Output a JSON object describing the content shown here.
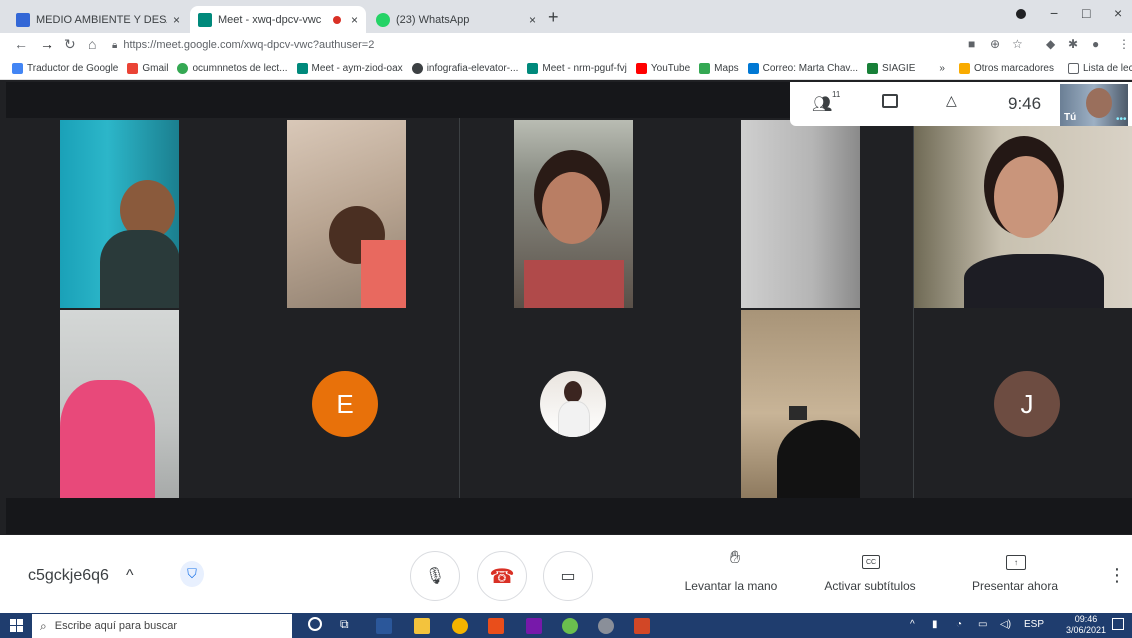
{
  "tabs": [
    {
      "title": "MEDIO AMBIENTE Y DESARROLL",
      "close": "×"
    },
    {
      "title": "Meet - xwq-dpcv-vwc",
      "close": "×"
    },
    {
      "title": "(23) WhatsApp",
      "close": "×"
    }
  ],
  "newtab": "+",
  "window": {
    "minimize": "−",
    "maximize": "□",
    "close": "×"
  },
  "address": {
    "url": "https://meet.google.com/xwq-dpcv-vwc?authuser=2"
  },
  "bookmarks": [
    {
      "label": "Traductor de Google",
      "color": "#4285f4"
    },
    {
      "label": "Gmail",
      "color": "#ea4335"
    },
    {
      "label": "ocumnnetos de lect...",
      "color": "#34a853"
    },
    {
      "label": "Meet - aym-ziod-oax",
      "color": "#00897b"
    },
    {
      "label": "infografia-elevator-...",
      "color": "#3c4043"
    },
    {
      "label": "Meet - nrm-pguf-fvj",
      "color": "#00897b"
    },
    {
      "label": "YouTube",
      "color": "#ff0000"
    },
    {
      "label": "Maps",
      "color": "#34a853"
    },
    {
      "label": "Correo: Marta Chav...",
      "color": "#0078d4"
    },
    {
      "label": "SIAGIE",
      "color": "#188038"
    }
  ],
  "bookmarks_overflow": "»",
  "bookmarks_other": "Otros marcadores",
  "bookmarks_reading": "Lista de lectura",
  "meet": {
    "participants_count": "11",
    "time": "9:46",
    "self_label": "Tú",
    "tiles": [
      {
        "initial": "E",
        "color": "#e8710a"
      },
      {
        "initial": "J",
        "color": "#6d4c41"
      }
    ]
  },
  "controls": {
    "meeting_code": "c5gckje6q6",
    "chevron": "^",
    "raise_hand": "Levantar la mano",
    "captions": "Activar subtítulos",
    "present": "Presentar ahora",
    "more": "⋮"
  },
  "taskbar": {
    "search_placeholder": "Escribe aquí para buscar",
    "lang": "ESP",
    "clock_time": "09:46",
    "clock_date": "3/06/2021"
  }
}
